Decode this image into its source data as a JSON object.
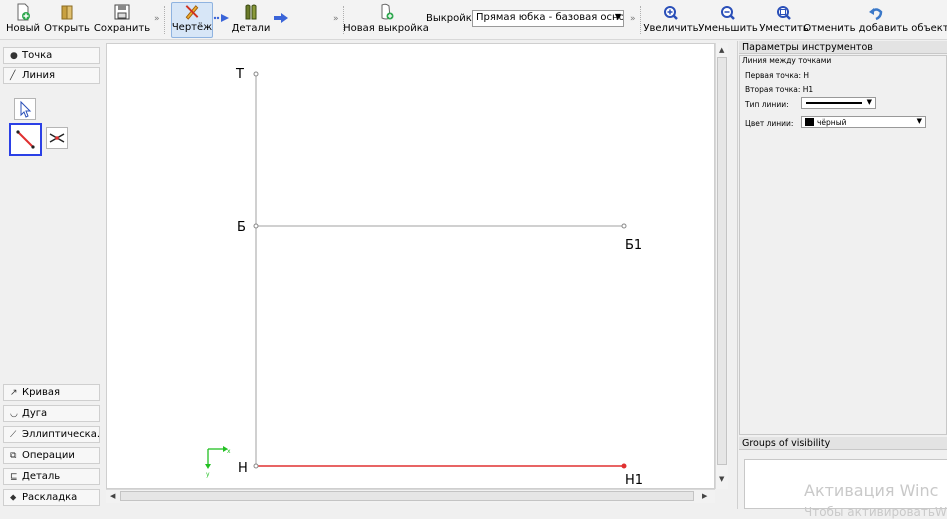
{
  "toolbar": {
    "new": "Новый",
    "open": "Открыть",
    "save": "Сохранить",
    "drawing": "Чертёж",
    "details": "Детали",
    "new_pattern": "Новая выкройка",
    "pattern_label": "Выкройка:",
    "pattern_value": "Прямая юбка - базовая основа",
    "zoom_in": "Увеличить",
    "zoom_out": "Уменьшить",
    "fit": "Уместить",
    "undo": "Отменить добавить объект",
    "extension_glyph": "»"
  },
  "left_panel": {
    "top_categories": [
      {
        "label": "Точка",
        "icon": "point-icon"
      },
      {
        "label": "Линия",
        "icon": "line-icon"
      }
    ],
    "bottom_categories": [
      {
        "label": "Кривая",
        "icon": "curve-icon"
      },
      {
        "label": "Дуга",
        "icon": "arc-icon"
      },
      {
        "label": "Эллиптическа...",
        "icon": "ellipse-icon"
      },
      {
        "label": "Операции",
        "icon": "operations-icon"
      },
      {
        "label": "Деталь",
        "icon": "detail-icon"
      },
      {
        "label": "Раскладка",
        "icon": "layout-icon"
      }
    ]
  },
  "canvas": {
    "points": {
      "T": "Т",
      "B": "Б",
      "B1": "Б1",
      "H": "Н",
      "H1": "Н1"
    },
    "axis": {
      "x": "x",
      "y": "y"
    }
  },
  "right_panel": {
    "title": "Параметры инструментов",
    "subtitle": "Линия между точками",
    "first_point_label": "Первая точка:",
    "first_point_value": "Н",
    "second_point_label": "Вторая точка:",
    "second_point_value": "Н1",
    "line_type_label": "Тип линии:",
    "line_color_label": "Цвет линии:",
    "line_color_value": "чёрный",
    "groups_title": "Groups of visibility"
  },
  "watermark": {
    "line1": "Активация Winc",
    "line2": "Чтобы активироватьW"
  },
  "colors": {
    "accent_blue": "#2b40e6",
    "selected_line": "#e03030",
    "guide_line": "#a0a0a0",
    "axis_green": "#22c022"
  }
}
